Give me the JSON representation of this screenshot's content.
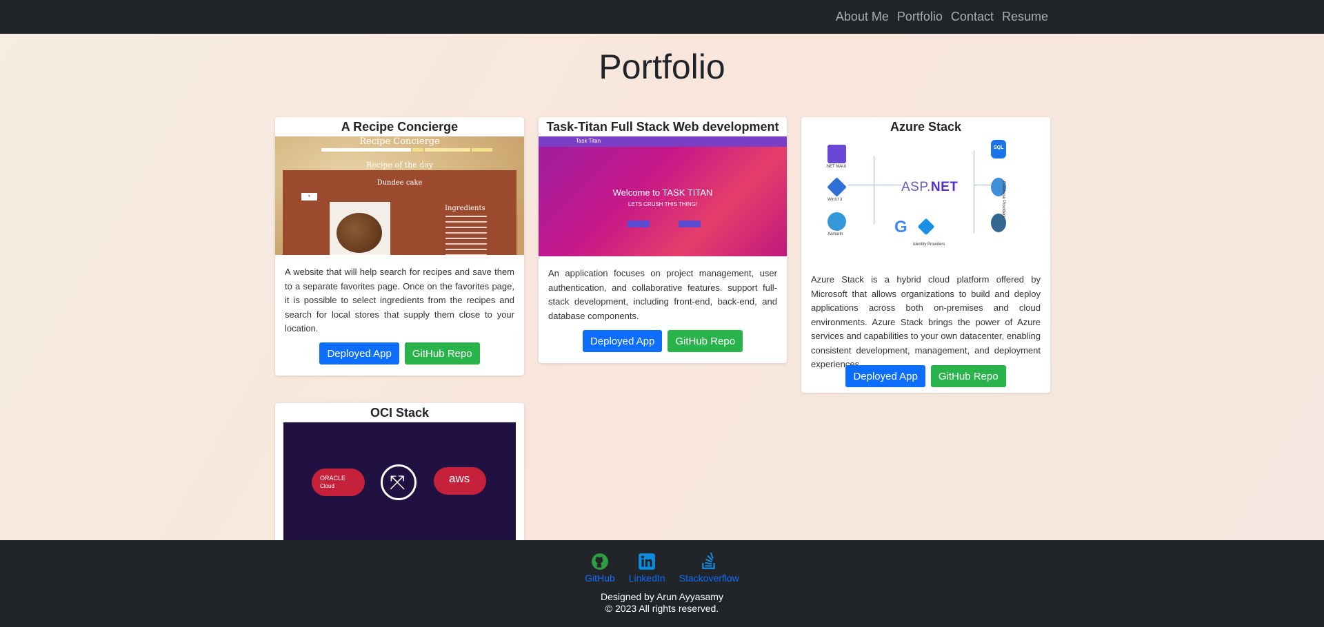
{
  "nav": {
    "links": [
      "About Me",
      "Portfolio",
      "Contact",
      "Resume"
    ]
  },
  "page_title": "Portfolio",
  "projects": [
    {
      "title": "A Recipe Concierge",
      "description": "A website that will help search for recipes and save them to a separate favorites page. Once on the favorites page, it is possible to select ingredients from the recipes and search for local stores that supply them close to your location.",
      "deployed_label": "Deployed App",
      "repo_label": "GitHub Repo",
      "image": {
        "header": "Recipe Concierge",
        "subtitle": "Recipe of the day",
        "dish": "Dundee cake",
        "ingredients_title": "Ingredients"
      }
    },
    {
      "title": "Task-Titan Full Stack Web development",
      "description": "An application focuses on project management, user authentication, and collaborative features. support full-stack development, including front-end, back-end, and database components.",
      "deployed_label": "Deployed App",
      "repo_label": "GitHub Repo",
      "image": {
        "bar_title": "Task Titan",
        "welcome": "Welcome to TASK TITAN",
        "tagline": "LETS CRUSH THIS THING!"
      }
    },
    {
      "title": "Azure Stack",
      "description": "Azure Stack is a hybrid cloud platform offered by Microsoft that allows organizations to build and deploy applications across both on-premises and cloud environments. Azure Stack brings the power of Azure services and capabilities to your own datacenter, enabling consistent development, management, and deployment experiences",
      "deployed_label": "Deployed App",
      "repo_label": "GitHub Repo",
      "image": {
        "logo_prefix": "ASP.",
        "logo_suffix": "NET",
        "left_labels": [
          ".NET MAUI",
          "WinUI 3",
          "Xamarin"
        ],
        "identity": "Identity Providers",
        "side": "Database Providers",
        "sql": "SQL"
      }
    },
    {
      "title": "OCI Stack",
      "image": {
        "left_cloud": "ORACLE",
        "left_cloud_sub": "Cloud",
        "right_cloud": "aws"
      }
    }
  ],
  "footer": {
    "social": [
      "GitHub",
      "LinkedIn",
      "Stackoverflow"
    ],
    "designed_by": "Designed by Arun Ayyasamy",
    "copyright": "© 2023 All rights reserved.",
    "colors": {
      "github": "#2ea043",
      "linkedin": "#0d8be0",
      "stackoverflow": "#1b8fe6"
    }
  }
}
